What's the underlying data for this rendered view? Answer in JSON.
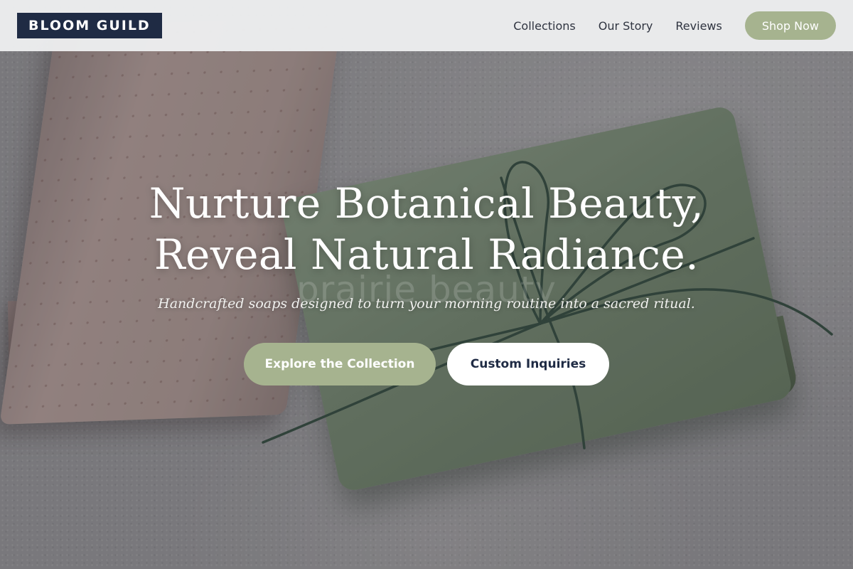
{
  "brand": {
    "logo_text": "BLOOM GUILD"
  },
  "nav": {
    "links": [
      "Collections",
      "Our Story",
      "Reviews"
    ],
    "shop_label": "Shop Now"
  },
  "hero": {
    "headline_line1": "Nurture Botanical Beauty,",
    "headline_line2": "Reveal Natural Radiance.",
    "tagline": "Handcrafted soaps designed to turn your morning routine into a sacred ritual.",
    "watermark": "prairie beauty",
    "primary_cta": "Explore the Collection",
    "secondary_cta": "Custom Inquiries"
  },
  "colors": {
    "navy": "#1f2b44",
    "sage": "#a6b38f",
    "nav_bg": "#eceeef",
    "white": "#ffffff"
  }
}
